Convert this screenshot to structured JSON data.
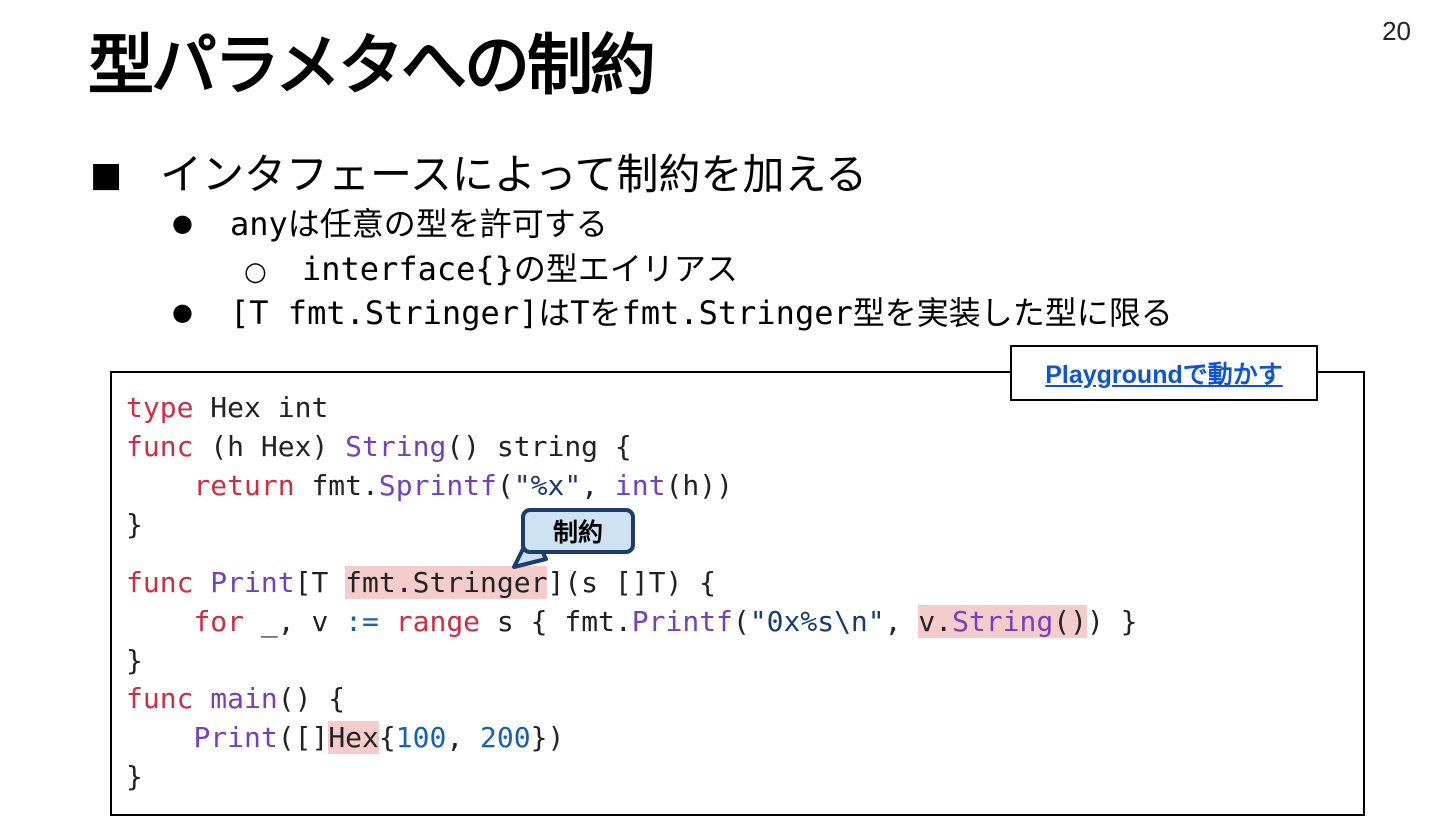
{
  "slide": {
    "page_number": "20",
    "title": "型パラメタへの制約"
  },
  "bullets": {
    "level1": {
      "marker": "■",
      "text": "インタフェースによって制約を加える"
    },
    "any": {
      "marker": "●",
      "code": "any",
      "text": "は任意の型を許可する"
    },
    "alias": {
      "marker": "○",
      "code": "interface{}",
      "text": "の型エイリアス"
    },
    "stringer": {
      "marker": "●",
      "code": "[T fmt.Stringer]",
      "text1": "は",
      "code2": "T",
      "text2": "を",
      "code3": "fmt.Stringer",
      "text3": "型を実装した型に限る"
    }
  },
  "playground": {
    "link_text": "Playgroundで動かす"
  },
  "callout": {
    "label": "制約"
  },
  "code": {
    "l1": {
      "kw": "type",
      "rest": " Hex int"
    },
    "l2": {
      "kw": "func",
      "a": " (h Hex) ",
      "fn": "String",
      "b": "() string {"
    },
    "l3": {
      "indent": "    ",
      "kw": "return",
      "a": " fmt.",
      "fn": "Sprintf",
      "b": "(",
      "str": "\"%x\"",
      "c": ", ",
      "fn2": "int",
      "d": "(h))"
    },
    "l4": {
      "text": "}"
    },
    "l5": {
      "kw": "func",
      "a": " ",
      "fn": "Print",
      "b": "[T ",
      "hl": "fmt.Stringer",
      "c": "](s []T) {"
    },
    "l6": {
      "indent": "    ",
      "kw": "for",
      "a": " _, v ",
      "op": ":=",
      "b": " ",
      "kw2": "range",
      "c": " s { fmt.",
      "fn": "Printf",
      "d": "(",
      "str": "\"0x%s\\n\"",
      "e": ", ",
      "hl_a": "v.",
      "hl_fn": "String",
      "hl_b": "()",
      "f": ") }"
    },
    "l7": {
      "text": "}"
    },
    "l8": {
      "kw": "func",
      "a": " ",
      "fn": "main",
      "b": "() {"
    },
    "l9": {
      "indent": "    ",
      "fn": "Print",
      "a": "([]",
      "hl": "Hex",
      "b": "{",
      "n1": "100",
      "c": ", ",
      "n2": "200",
      "d": "})"
    },
    "l10": {
      "text": "}"
    }
  },
  "colors": {
    "keyword": "#cc2e43",
    "function": "#7541b8",
    "number": "#1761b3",
    "highlight": "#f4cccc",
    "link": "#1155cc",
    "callout_fill": "#cfe2f3",
    "callout_border": "#1c3d6c"
  }
}
